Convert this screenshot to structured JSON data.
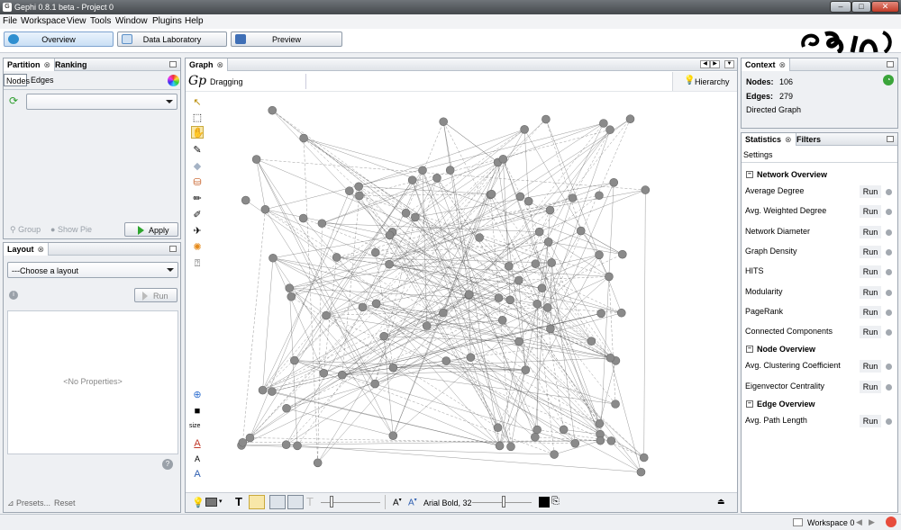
{
  "window": {
    "title": "Gephi 0.8.1 beta - Project 0",
    "app_icon": "gephi-icon"
  },
  "menu": [
    "File",
    "Workspace",
    "View",
    "Tools",
    "Window",
    "Plugins",
    "Help"
  ],
  "workspace_tabs": [
    {
      "label": "Overview",
      "active": true,
      "color": "#2f8fd0"
    },
    {
      "label": "Data Laboratory",
      "active": false,
      "color": "#5b8fc7"
    },
    {
      "label": "Preview",
      "active": false,
      "color": "#3f6fb6"
    }
  ],
  "partition_panel": {
    "tabs": [
      "Partition",
      "Ranking"
    ],
    "subtabs": [
      "Nodes",
      "Edges"
    ],
    "group_label": "Group",
    "show_pie_label": "Show Pie",
    "apply_label": "Apply"
  },
  "layout_panel": {
    "tab": "Layout",
    "choose_label": "---Choose a layout",
    "run_label": "Run",
    "no_properties": "<No Properties>",
    "presets_label": "Presets...",
    "reset_label": "Reset"
  },
  "graph_panel": {
    "tab": "Graph",
    "mode_label": "Dragging",
    "hierarchy_label": "Hierarchy",
    "font_label": "Arial Bold, 32",
    "size_label": "size"
  },
  "context_panel": {
    "tab": "Context",
    "nodes_label": "Nodes:",
    "nodes_value": "106",
    "edges_label": "Edges:",
    "edges_value": "279",
    "graph_type": "Directed Graph"
  },
  "statistics_panel": {
    "tabs": [
      "Statistics",
      "Filters"
    ],
    "settings_label": "Settings",
    "run_label": "Run",
    "sections": [
      {
        "title": "Network Overview",
        "items": [
          "Average Degree",
          "Avg. Weighted Degree",
          "Network Diameter",
          "Graph Density",
          "HITS",
          "Modularity",
          "PageRank",
          "Connected Components"
        ]
      },
      {
        "title": "Node Overview",
        "items": [
          "Avg. Clustering Coefficient",
          "Eigenvector Centrality"
        ]
      },
      {
        "title": "Edge Overview",
        "items": [
          "Avg. Path Length"
        ]
      }
    ]
  },
  "status_bar": {
    "workspace_label": "Workspace 0"
  },
  "colors": {
    "node_fill": "#8a8a8a",
    "edge_stroke": "#555555",
    "accent": "#f7c948"
  }
}
